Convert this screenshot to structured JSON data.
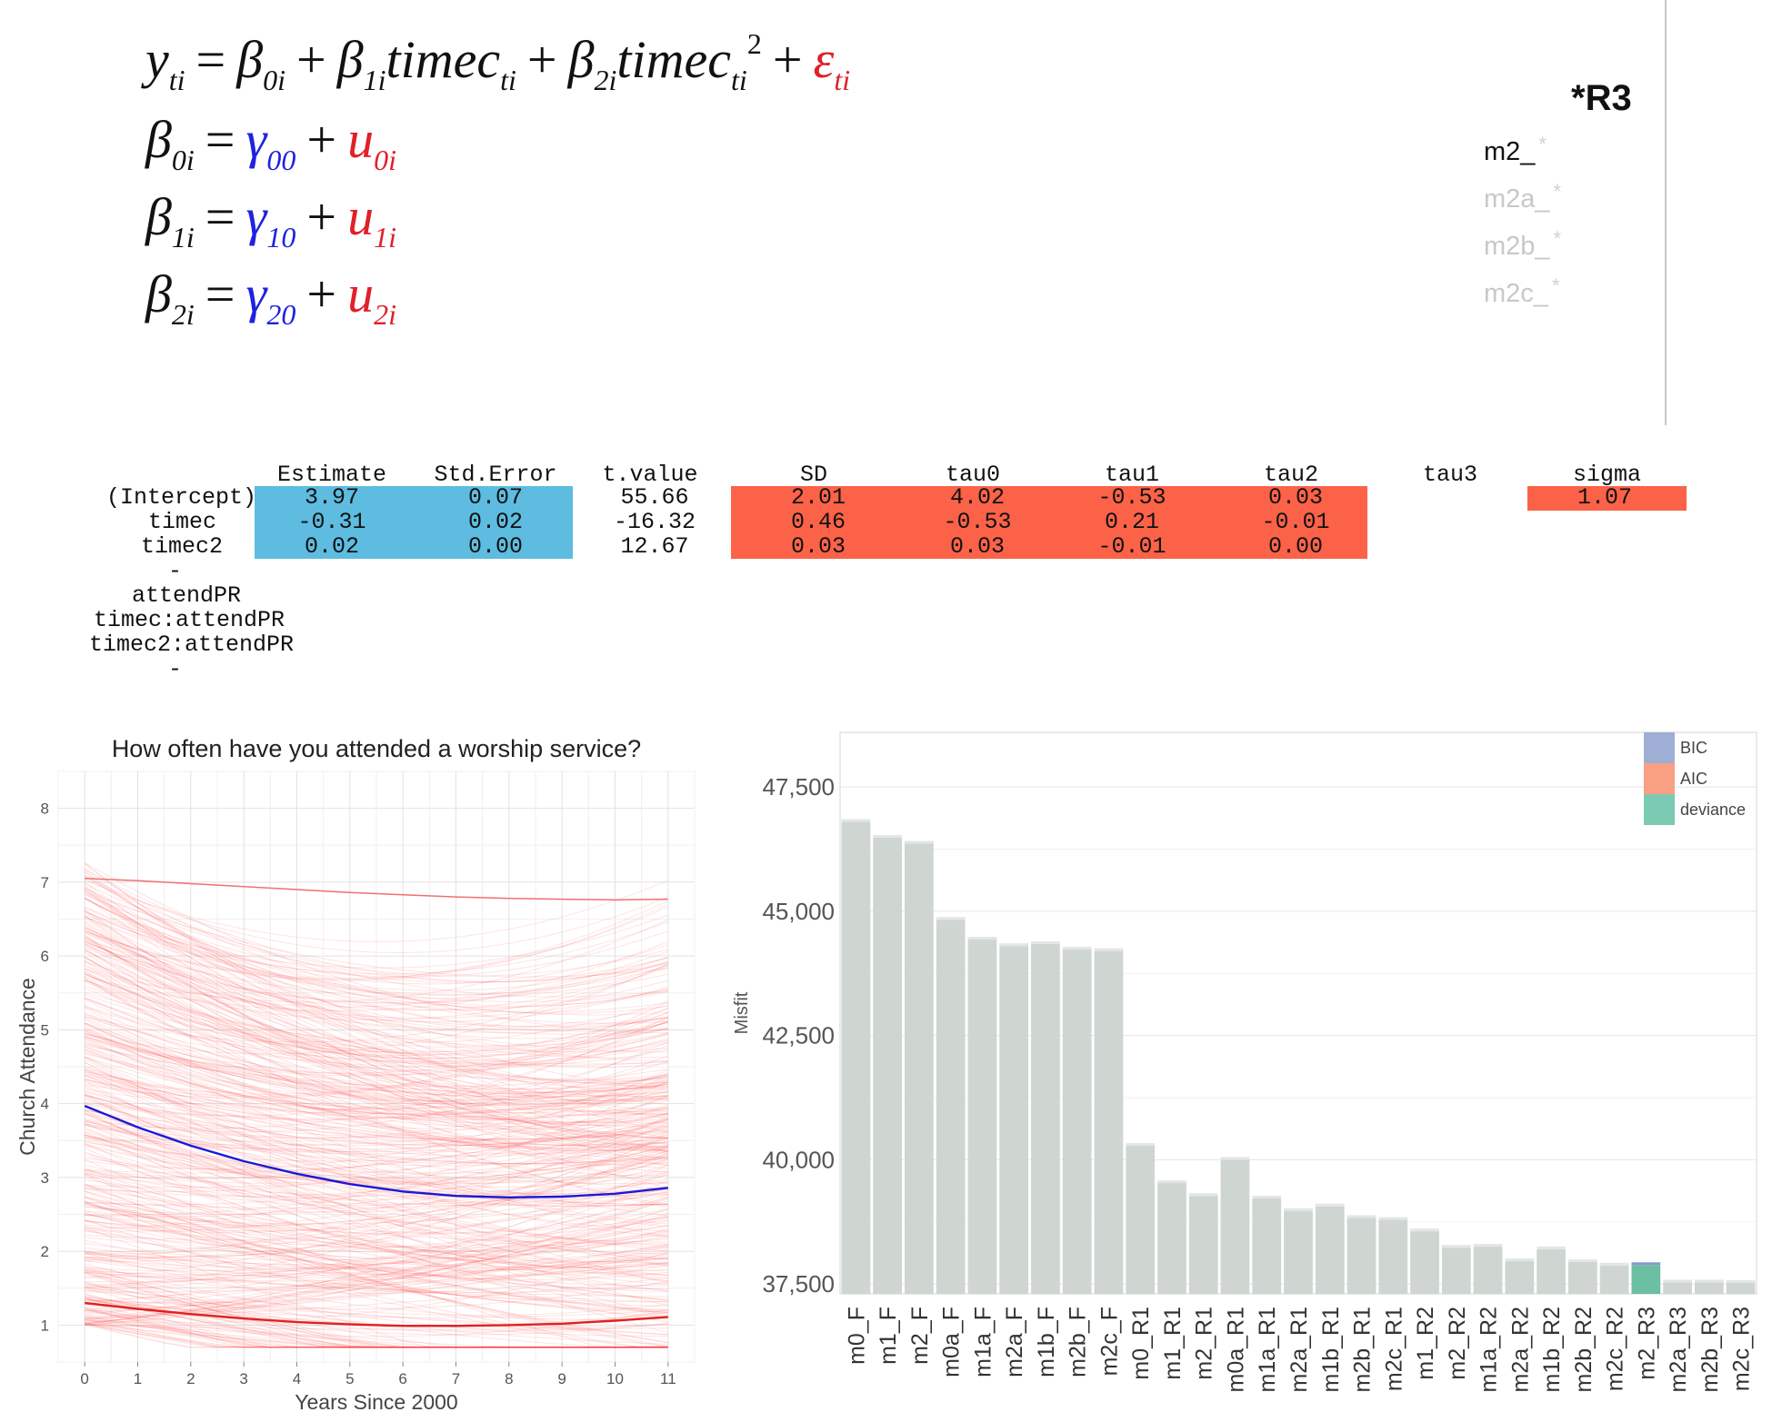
{
  "equations": {
    "level1": {
      "lhs": "y",
      "lhs_sub": "ti",
      "b0": "β",
      "b0_sub": "0i",
      "b1": "β",
      "b1_sub": "1i",
      "t1": "timec",
      "t1_sub": "ti",
      "b2": "β",
      "b2_sub": "2i",
      "t2": "timec",
      "t2_sub": "ti",
      "t2_sup": "2",
      "eps": "ε",
      "eps_sub": "ti"
    },
    "level2": [
      {
        "lhs": "β",
        "lhs_sub": "0i",
        "gamma": "γ",
        "gamma_sub": "00",
        "u": "u",
        "u_sub": "0i"
      },
      {
        "lhs": "β",
        "lhs_sub": "1i",
        "gamma": "γ",
        "gamma_sub": "10",
        "u": "u",
        "u_sub": "1i"
      },
      {
        "lhs": "β",
        "lhs_sub": "2i",
        "gamma": "γ",
        "gamma_sub": "20",
        "u": "u",
        "u_sub": "2i"
      }
    ],
    "eq_sign": "=",
    "plus": "+"
  },
  "model_panel": {
    "current": "*R3",
    "models": [
      {
        "label": "m2_",
        "star": "*",
        "color": "#111111"
      },
      {
        "label": "m2a_",
        "star": "*",
        "color": "#c8c8c8"
      },
      {
        "label": "m2b_",
        "star": "*",
        "color": "#c8c8c8"
      },
      {
        "label": "m2c_",
        "star": "*",
        "color": "#c8c8c8"
      }
    ]
  },
  "table": {
    "headers": [
      "Estimate",
      "Std.Error",
      "t.value",
      "SD",
      "tau0",
      "tau1",
      "tau2",
      "tau3",
      "sigma"
    ],
    "row_labels": [
      "(Intercept)",
      "timec",
      "timec2"
    ],
    "extra_labels": [
      "-",
      "attendPR",
      "timec:attendPR",
      "timec2:attendPR",
      "-"
    ],
    "rows": [
      [
        "3.97",
        "0.07",
        "55.66",
        "2.01",
        "4.02",
        "-0.53",
        "0.03",
        "",
        "1.07"
      ],
      [
        "-0.31",
        "0.02",
        "-16.32",
        "0.46",
        "-0.53",
        "0.21",
        "-0.01",
        "",
        ""
      ],
      [
        "0.02",
        "0.00",
        "12.67",
        "0.03",
        "0.03",
        "-0.01",
        "0.00",
        "",
        ""
      ]
    ],
    "colors": {
      "fixed": "#5dbce0",
      "random": "#fb6248"
    }
  },
  "chart_data": [
    {
      "type": "line",
      "title": "How often have you attended a worship service?",
      "xlabel": "Years Since 2000",
      "ylabel": "Church Attendance",
      "xlim": [
        -0.5,
        11.5
      ],
      "ylim": [
        0.5,
        8.5
      ],
      "xticks": [
        "0",
        "1",
        "2",
        "3",
        "4",
        "5",
        "6",
        "7",
        "8",
        "9",
        "10",
        "11"
      ],
      "yticks": [
        "1",
        "2",
        "3",
        "4",
        "5",
        "6",
        "7",
        "8"
      ],
      "grid": true,
      "series": [
        {
          "color": "#1a1ad8",
          "x": [
            0,
            1,
            2,
            3,
            4,
            5,
            6,
            7,
            8,
            9,
            10,
            11
          ],
          "y": [
            3.97,
            3.68,
            3.43,
            3.22,
            3.05,
            2.91,
            2.81,
            2.75,
            2.73,
            2.74,
            2.78,
            2.86
          ]
        },
        {
          "color": "#e32020",
          "x": [
            0,
            1,
            2,
            3,
            4,
            5,
            6,
            7,
            8,
            9,
            10,
            11
          ],
          "y": [
            1.3,
            1.22,
            1.15,
            1.09,
            1.04,
            1.01,
            0.99,
            0.99,
            1.0,
            1.02,
            1.06,
            1.11
          ]
        },
        {
          "color": "#f07070",
          "x": [
            0,
            1,
            2,
            3,
            4,
            5,
            6,
            7,
            8,
            9,
            10,
            11
          ],
          "y": [
            7.05,
            7.02,
            6.98,
            6.94,
            6.9,
            6.86,
            6.83,
            6.8,
            6.78,
            6.77,
            6.76,
            6.77
          ]
        }
      ],
      "individual_lines_color": "#ff3030"
    },
    {
      "type": "bar",
      "ylabel": "Misfit",
      "xlabel": "",
      "ylim": [
        37300,
        48600
      ],
      "yticks": [
        "37,500",
        "40,000",
        "42,500",
        "45,000",
        "47,500"
      ],
      "ytick_values": [
        37500,
        40000,
        42500,
        45000,
        47500
      ],
      "legend": {
        "position": "top-right",
        "entries": [
          {
            "name": "BIC",
            "color": "#9eaed4"
          },
          {
            "name": "AIC",
            "color": "#f9a083"
          },
          {
            "name": "deviance",
            "color": "#7ccab2"
          }
        ]
      },
      "bar_color": "#cfd6d2",
      "highlight": {
        "category": "m2_R3",
        "color": "#6bbfa3",
        "bic_color": "#8a96c9"
      },
      "categories": [
        "m0_F",
        "m1_F",
        "m2_F",
        "m0a_F",
        "m1a_F",
        "m2a_F",
        "m1b_F",
        "m2b_F",
        "m2c_F",
        "m0_R1",
        "m1_R1",
        "m2_R1",
        "m0a_R1",
        "m1a_R1",
        "m2a_R1",
        "m1b_R1",
        "m2b_R1",
        "m2c_R1",
        "m1_R2",
        "m2_R2",
        "m1a_R2",
        "m2a_R2",
        "m1b_R2",
        "m2b_R2",
        "m2c_R2",
        "m2_R3",
        "m2a_R3",
        "m2b_R3",
        "m2c_R3"
      ],
      "values": [
        46800,
        46480,
        46360,
        44830,
        44430,
        44300,
        44340,
        44230,
        44200,
        40280,
        39530,
        39270,
        40000,
        39220,
        38970,
        39060,
        38830,
        38790,
        38560,
        38230,
        38250,
        37960,
        38200,
        37940,
        37870,
        37880,
        37530,
        37530,
        37520
      ]
    }
  ]
}
